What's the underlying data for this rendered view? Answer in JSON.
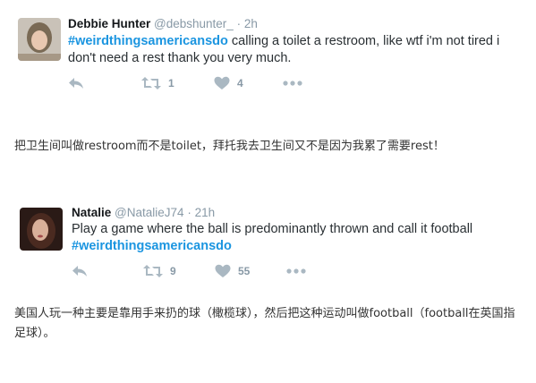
{
  "tweets": [
    {
      "name": "Debbie Hunter",
      "handle": "@debshunter_",
      "separator": "·",
      "time": "2h",
      "hashtag": "#weirdthingsamericansdo",
      "text_after_hashtag": " calling a toilet a restroom, like wtf i'm not tired i don't need a rest thank you very much.",
      "retweets": "1",
      "likes": "4"
    },
    {
      "name": "Natalie",
      "handle": "@NatalieJ74",
      "separator": "·",
      "time": "21h",
      "text_before_hashtag": "Play a game where the ball is predominantly thrown and call it football",
      "hashtag": "#weirdthingsamericansdo",
      "retweets": "9",
      "likes": "55"
    }
  ],
  "captions": [
    "把卫生间叫做restroom而不是toilet，拜托我去卫生间又不是因为我累了需要rest！",
    "美国人玩一种主要是靠用手来扔的球（橄榄球），然后把这种运动叫做football（football在英国指足球）。"
  ],
  "icons": {
    "reply": "reply-arrow-icon",
    "retweet": "retweet-icon",
    "like": "heart-icon",
    "more": "more-dots-icon"
  },
  "colors": {
    "hashtag": "#1b95e0",
    "muted": "#8899a6",
    "icon": "#aab8c2"
  }
}
